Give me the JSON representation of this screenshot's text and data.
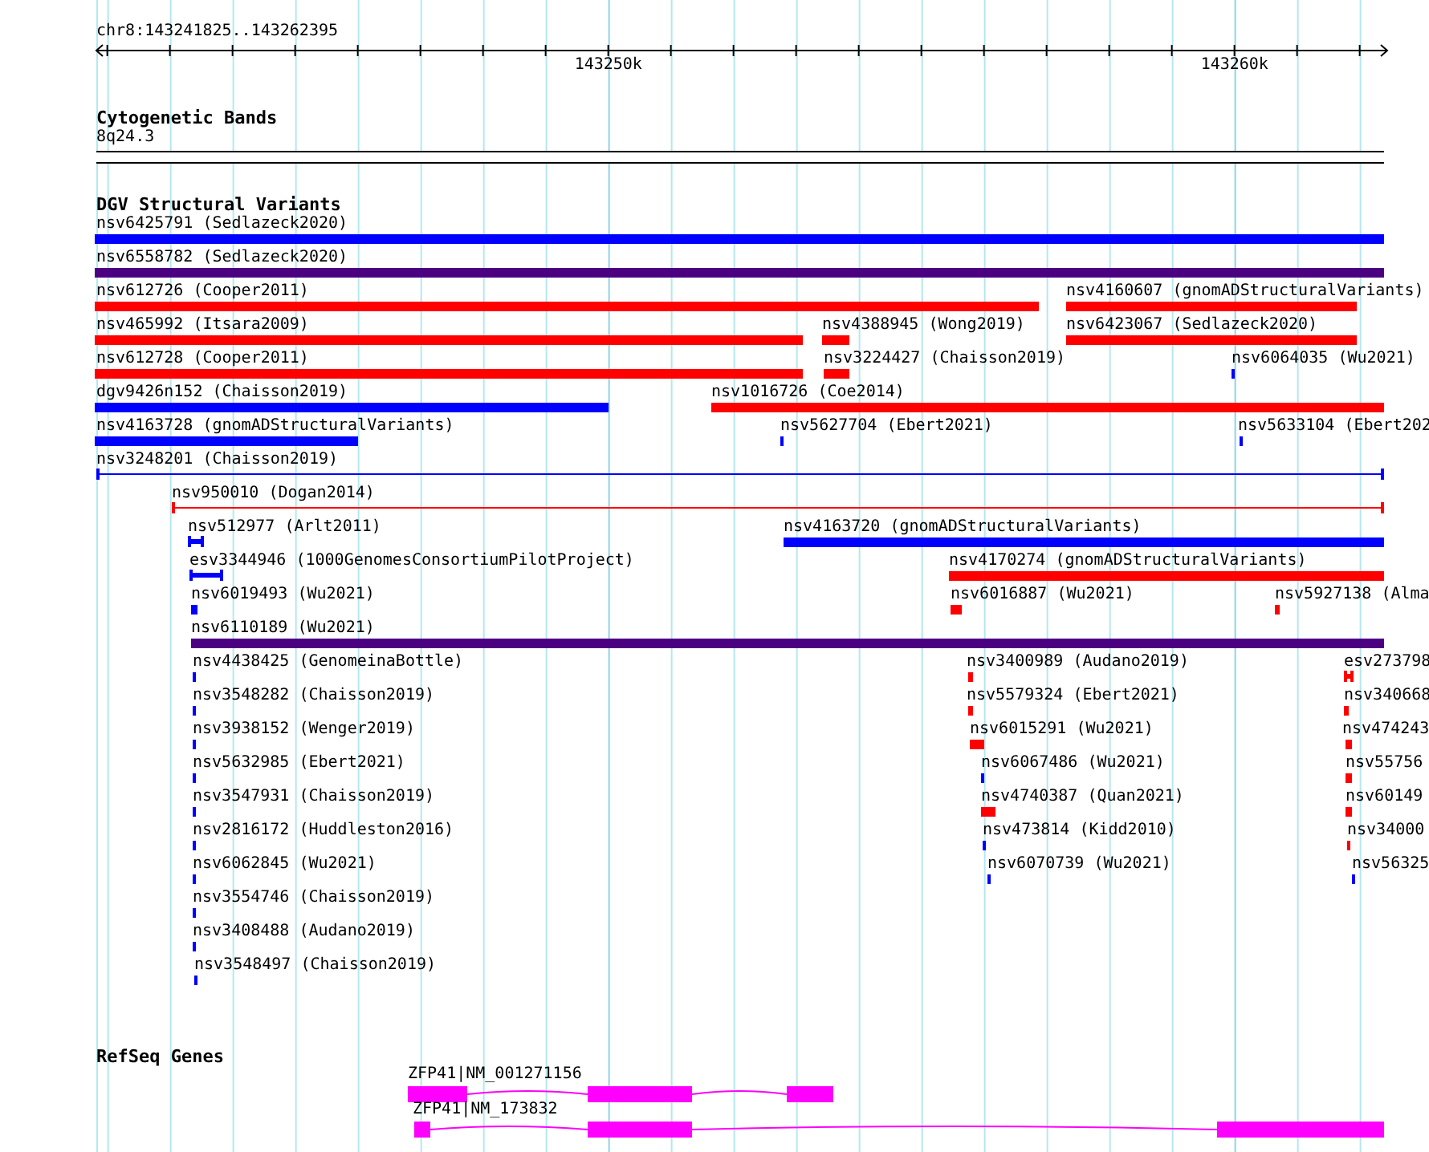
{
  "location": "chr8:143241825..143262395",
  "axis": {
    "labels": [
      "143250k",
      "143260k"
    ]
  },
  "tracks": [
    {
      "kind": "cytoband",
      "title": "Cytogenetic Bands",
      "band": "8q24.3"
    },
    {
      "kind": "variants",
      "title": "DGV Structural Variants",
      "features": [
        {
          "label": "nsv6425791 (Sedlazeck2020)",
          "kind": "bar",
          "color": "#0000ff"
        },
        {
          "label": "nsv6558782 (Sedlazeck2020)",
          "kind": "bar",
          "color": "#4b0082"
        },
        {
          "label": "nsv612726 (Cooper2011)",
          "kind": "bar",
          "color": "#ff0000"
        },
        {
          "label": "nsv4160607 (gnomADStructuralVariants)",
          "kind": "bar",
          "color": "#ff0000"
        },
        {
          "label": "nsv465992 (Itsara2009)",
          "kind": "bar",
          "color": "#ff0000"
        },
        {
          "label": "nsv4388945 (Wong2019)",
          "kind": "bar",
          "color": "#ff0000"
        },
        {
          "label": "nsv6423067 (Sedlazeck2020)",
          "kind": "bar",
          "color": "#ff0000"
        },
        {
          "label": "nsv612728 (Cooper2011)",
          "kind": "bar",
          "color": "#ff0000"
        },
        {
          "label": "nsv3224427 (Chaisson2019)",
          "kind": "bar",
          "color": "#ff0000"
        },
        {
          "label": "nsv6064035 (Wu2021)",
          "kind": "bar",
          "color": "#0000ff"
        },
        {
          "label": "dgv9426n152 (Chaisson2019)",
          "kind": "bar",
          "color": "#0000ff"
        },
        {
          "label": "nsv1016726 (Coe2014)",
          "kind": "bar",
          "color": "#ff0000"
        },
        {
          "label": "nsv4163728 (gnomADStructuralVariants)",
          "kind": "bar",
          "color": "#0000ff"
        },
        {
          "label": "nsv5627704 (Ebert2021)",
          "kind": "bar",
          "color": "#0000ff"
        },
        {
          "label": "nsv5633104 (Ebert202",
          "kind": "bar",
          "color": "#0000ff"
        },
        {
          "label": "nsv3248201 (Chaisson2019)",
          "kind": "line",
          "color": "#0000ff"
        },
        {
          "label": "nsv950010 (Dogan2014)",
          "kind": "line",
          "color": "#ff0000"
        },
        {
          "label": "nsv512977 (Arlt2011)",
          "kind": "capped",
          "color": "#0000ff"
        },
        {
          "label": "nsv4163720 (gnomADStructuralVariants)",
          "kind": "bar",
          "color": "#0000ff"
        },
        {
          "label": "esv3344946 (1000GenomesConsortiumPilotProject)",
          "kind": "capped",
          "color": "#0000ff"
        },
        {
          "label": "nsv4170274 (gnomADStructuralVariants)",
          "kind": "bar",
          "color": "#ff0000"
        },
        {
          "label": "nsv6019493 (Wu2021)",
          "kind": "bar",
          "color": "#0000ff"
        },
        {
          "label": "nsv6016887 (Wu2021)",
          "kind": "bar",
          "color": "#ff0000"
        },
        {
          "label": "nsv5927138 (Alma",
          "kind": "bar",
          "color": "#ff0000"
        },
        {
          "label": "nsv6110189 (Wu2021)",
          "kind": "bar",
          "color": "#4b0082"
        },
        {
          "label": "nsv4438425 (GenomeinaBottle)",
          "kind": "bar",
          "color": "#0000ff"
        },
        {
          "label": "nsv3400989 (Audano2019)",
          "kind": "bar",
          "color": "#ff0000"
        },
        {
          "label": "esv273798",
          "kind": "capped",
          "color": "#ff0000"
        },
        {
          "label": "nsv3548282 (Chaisson2019)",
          "kind": "bar",
          "color": "#0000ff"
        },
        {
          "label": "nsv5579324 (Ebert2021)",
          "kind": "bar",
          "color": "#ff0000"
        },
        {
          "label": "nsv340668",
          "kind": "bar",
          "color": "#ff0000"
        },
        {
          "label": "nsv3938152 (Wenger2019)",
          "kind": "bar",
          "color": "#0000ff"
        },
        {
          "label": "nsv6015291 (Wu2021)",
          "kind": "bar",
          "color": "#ff0000"
        },
        {
          "label": "nsv474243",
          "kind": "bar",
          "color": "#ff0000"
        },
        {
          "label": "nsv5632985 (Ebert2021)",
          "kind": "bar",
          "color": "#0000ff"
        },
        {
          "label": "nsv6067486 (Wu2021)",
          "kind": "bar",
          "color": "#0000ff"
        },
        {
          "label": "nsv55756",
          "kind": "bar",
          "color": "#ff0000"
        },
        {
          "label": "nsv3547931 (Chaisson2019)",
          "kind": "bar",
          "color": "#0000ff"
        },
        {
          "label": "nsv4740387 (Quan2021)",
          "kind": "bar",
          "color": "#ff0000"
        },
        {
          "label": "nsv60149",
          "kind": "bar",
          "color": "#ff0000"
        },
        {
          "label": "nsv2816172 (Huddleston2016)",
          "kind": "bar",
          "color": "#0000ff"
        },
        {
          "label": "nsv473814 (Kidd2010)",
          "kind": "bar",
          "color": "#0000ff"
        },
        {
          "label": "nsv34000",
          "kind": "bar",
          "color": "#ff0000"
        },
        {
          "label": "nsv6062845 (Wu2021)",
          "kind": "bar",
          "color": "#0000ff"
        },
        {
          "label": "nsv6070739 (Wu2021)",
          "kind": "bar",
          "color": "#0000ff"
        },
        {
          "label": "nsv56325",
          "kind": "bar",
          "color": "#0000ff"
        },
        {
          "label": "nsv3554746 (Chaisson2019)",
          "kind": "bar",
          "color": "#0000ff"
        },
        {
          "label": "nsv3408488 (Audano2019)",
          "kind": "bar",
          "color": "#0000ff"
        },
        {
          "label": "nsv3548497 (Chaisson2019)",
          "kind": "bar",
          "color": "#0000ff"
        }
      ]
    },
    {
      "kind": "genes",
      "title": "RefSeq Genes",
      "transcripts": [
        {
          "label": "ZFP41|NM_001271156"
        },
        {
          "label": "ZFP41|NM_173832"
        }
      ]
    }
  ]
}
